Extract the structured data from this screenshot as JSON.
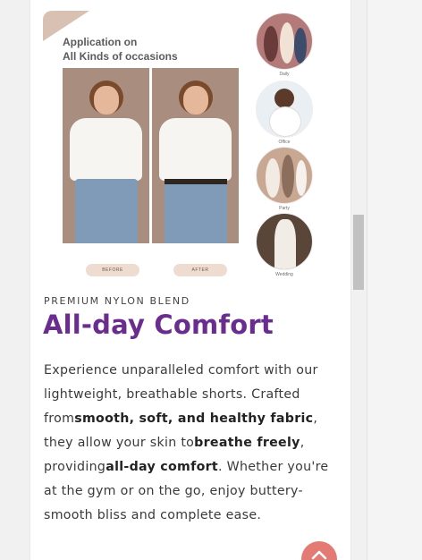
{
  "image": {
    "heading_line1": "Application on",
    "heading_line2": "All Kinds of occasions",
    "before_label": "BEFORE",
    "after_label": "AFTER",
    "occasions": [
      "Daily",
      "Office",
      "Party",
      "Wedding"
    ]
  },
  "section": {
    "eyebrow": "PREMIUM NYLON BLEND",
    "title": "All-day Comfort",
    "body_part1": "Experience unparalleled comfort with our lightweight, breathable shorts. Crafted from",
    "body_bold1": "smooth, soft, and healthy fabric",
    "body_part2": ", they allow your skin to",
    "body_bold2": "breathe freely",
    "body_part3": ", providing",
    "body_bold3": "all-day comfort",
    "body_part4": ". Whether you're at the gym or on the go, enjoy buttery-smooth bliss and complete ease."
  },
  "colors": {
    "title": "#6a2d8f",
    "scroll_button": "#e47a74"
  },
  "icons": {
    "scroll_top": "chevron-up-icon"
  }
}
